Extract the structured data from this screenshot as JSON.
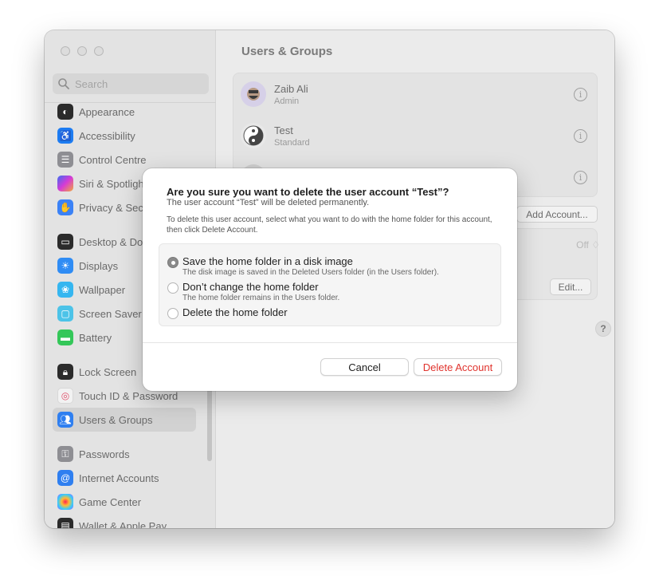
{
  "sidebar": {
    "search_placeholder": "Search",
    "items": [
      {
        "label": "Appearance",
        "color": "#2b2b2b",
        "icon": "appearance-icon"
      },
      {
        "label": "Accessibility",
        "color": "#1d7cf2",
        "icon": "accessibility-icon"
      },
      {
        "label": "Control Centre",
        "color": "#8e8e93",
        "icon": "control-centre-icon"
      },
      {
        "label": "Siri & Spotlight",
        "color": "#c844d6",
        "icon": "siri-icon"
      },
      {
        "label": "Privacy & Security",
        "color": "#3b82f6",
        "icon": "hand-icon"
      },
      {
        "label": "Desktop & Dock",
        "color": "#2b2b2b",
        "icon": "dock-icon"
      },
      {
        "label": "Displays",
        "color": "#2f8cf4",
        "icon": "sun-icon"
      },
      {
        "label": "Wallpaper",
        "color": "#35b6f0",
        "icon": "flower-icon"
      },
      {
        "label": "Screen Saver",
        "color": "#4cc3e8",
        "icon": "screensaver-icon"
      },
      {
        "label": "Battery",
        "color": "#34c759",
        "icon": "battery-icon"
      },
      {
        "label": "Lock Screen",
        "color": "#2b2b2b",
        "icon": "lock-icon"
      },
      {
        "label": "Touch ID & Password",
        "color": "#f2f2f2",
        "icon": "fingerprint-icon"
      },
      {
        "label": "Users & Groups",
        "color": "#2f7ff0",
        "icon": "users-icon"
      },
      {
        "label": "Passwords",
        "color": "#8e8e93",
        "icon": "key-icon"
      },
      {
        "label": "Internet Accounts",
        "color": "#2f7ff0",
        "icon": "at-icon"
      },
      {
        "label": "Game Center",
        "color": "#e9e9e9",
        "icon": "game-center-icon"
      },
      {
        "label": "Wallet & Apple Pay",
        "color": "#2b2b2b",
        "icon": "wallet-icon"
      }
    ]
  },
  "main": {
    "title": "Users & Groups",
    "users": [
      {
        "name": "Zaib Ali",
        "role": "Admin"
      },
      {
        "name": "Test",
        "role": "Standard"
      }
    ],
    "add_account": "Add Account...",
    "off_value": "Off ♢",
    "edit": "Edit...",
    "help": "?"
  },
  "dialog": {
    "title": "Are you sure you want to delete the user account “Test”?",
    "subtitle": "The user account “Test” will be deleted permanently.",
    "description": "To delete this user account, select what you want to do with the home folder for this account, then click Delete Account.",
    "options": [
      {
        "label": "Save the home folder in a disk image",
        "hint": "The disk image is saved in the Deleted Users folder (in the Users folder).",
        "selected": true
      },
      {
        "label": "Don’t change the home folder",
        "hint": "The home folder remains in the Users folder.",
        "selected": false
      },
      {
        "label": "Delete the home folder",
        "hint": "",
        "selected": false
      }
    ],
    "cancel": "Cancel",
    "delete": "Delete Account",
    "delete_color": "#e0332d"
  }
}
